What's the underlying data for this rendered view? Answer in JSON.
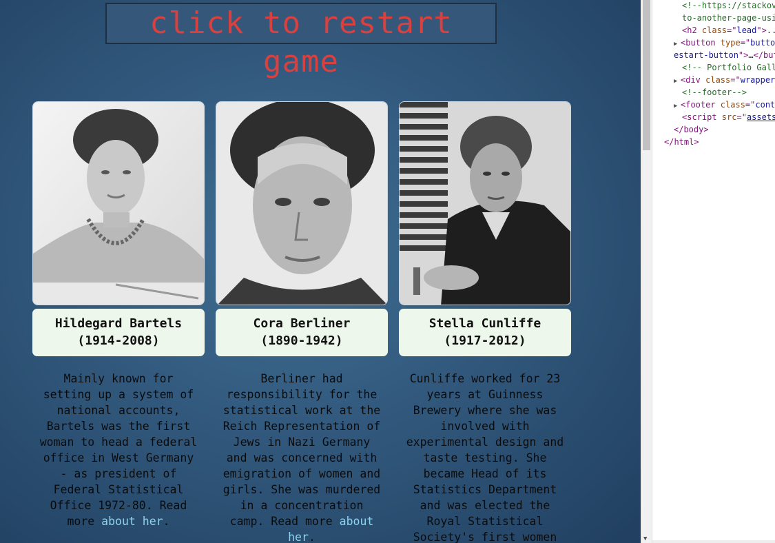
{
  "restart_button": {
    "label": "click to restart game"
  },
  "cards": [
    {
      "name": "Hildegard Bartels",
      "years": "(1914-2008)",
      "bio_lines": [
        "Mainly known for",
        "setting up a system of",
        "national accounts,",
        "Bartels was the first",
        "woman to head a federal",
        "office in West Germany",
        "- as president of",
        "Federal Statistical",
        "Office 1972-80. Read"
      ],
      "bio_tail": "more ",
      "link_text": "about her",
      "after_link": "."
    },
    {
      "name": "Cora Berliner",
      "years": "(1890-1942)",
      "bio_lines": [
        "Berliner had",
        "responsibility for the",
        "statistical work at the",
        "Reich Representation of",
        "Jews in Nazi Germany",
        "and was concerned with",
        "emigration of women and",
        "girls. She was murdered",
        "in a concentration"
      ],
      "bio_tail": "camp. Read more ",
      "link_text": "about",
      "link_text_2": "her",
      "after_link": "."
    },
    {
      "name": "Stella Cunliffe",
      "years": "(1917-2012)",
      "bio_lines": [
        "Cunliffe worked for 23",
        "years at Guinness",
        "Brewery where she was",
        "involved with",
        "experimental design and",
        "taste testing. She",
        "became Head of its",
        "Statistics Department",
        "and was elected the",
        "Royal Statistical",
        "Society's first women"
      ]
    }
  ],
  "devtools": {
    "lines": [
      {
        "parts": [
          {
            "cls": "c-comment",
            "text": "<!--https://stackov"
          }
        ]
      },
      {
        "parts": [
          {
            "cls": "c-comment",
            "text": "to-another-page-usi"
          }
        ]
      },
      {
        "parts": [
          {
            "cls": "c-tag",
            "text": "<h2 "
          },
          {
            "cls": "c-attr",
            "text": "class"
          },
          {
            "cls": "c-tag",
            "text": "=\""
          },
          {
            "cls": "c-val",
            "text": "lead"
          },
          {
            "cls": "c-tag",
            "text": "\">"
          },
          {
            "cls": "c-text",
            "text": ".."
          }
        ]
      },
      {
        "parts": [
          {
            "cls": "c-tag",
            "text": "<button "
          },
          {
            "cls": "c-attr",
            "text": "type"
          },
          {
            "cls": "c-tag",
            "text": "=\""
          },
          {
            "cls": "c-val",
            "text": "butto"
          }
        ]
      },
      {
        "parts": [
          {
            "cls": "c-val",
            "text": "estart-button"
          },
          {
            "cls": "c-tag",
            "text": "\">"
          },
          {
            "cls": "c-text",
            "text": "…"
          },
          {
            "cls": "c-tag",
            "text": "</but"
          }
        ]
      },
      {
        "parts": [
          {
            "cls": "c-comment",
            "text": "<!-- Portfolio Gall"
          }
        ]
      },
      {
        "parts": [
          {
            "cls": "c-tag",
            "text": "<div "
          },
          {
            "cls": "c-attr",
            "text": "class"
          },
          {
            "cls": "c-tag",
            "text": "=\""
          },
          {
            "cls": "c-val",
            "text": "wrapper"
          }
        ]
      },
      {
        "parts": [
          {
            "cls": "c-comment",
            "text": "<!--footer-->"
          }
        ]
      },
      {
        "parts": [
          {
            "cls": "c-tag",
            "text": "<footer "
          },
          {
            "cls": "c-attr",
            "text": "class"
          },
          {
            "cls": "c-tag",
            "text": "=\""
          },
          {
            "cls": "c-val",
            "text": "cont"
          }
        ]
      },
      {
        "parts": [
          {
            "cls": "c-tag",
            "text": "<script "
          },
          {
            "cls": "c-attr",
            "text": "src"
          },
          {
            "cls": "c-tag",
            "text": "=\""
          },
          {
            "cls": "c-link",
            "text": "assets"
          }
        ]
      },
      {
        "parts": [
          {
            "cls": "c-tag",
            "text": "</body>"
          }
        ]
      },
      {
        "parts": [
          {
            "cls": "c-tag",
            "text": "</html>"
          }
        ]
      }
    ]
  }
}
